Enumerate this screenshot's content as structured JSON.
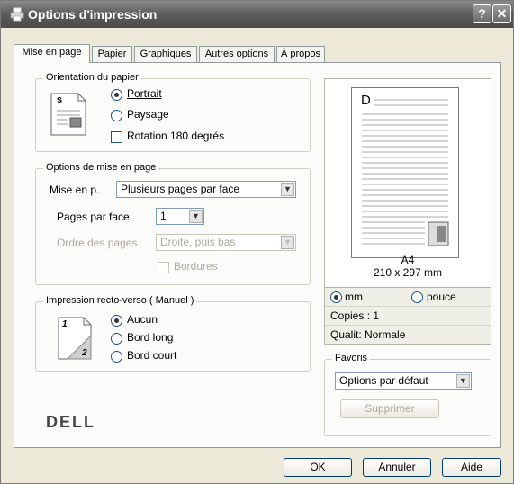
{
  "window": {
    "title": "Options d'impression",
    "help_label": "?",
    "close_label": "✕"
  },
  "tabs": [
    {
      "label": "Mise en page",
      "active": true
    },
    {
      "label": "Papier",
      "active": false
    },
    {
      "label": "Graphiques",
      "active": false
    },
    {
      "label": "Autres options",
      "active": false
    },
    {
      "label": "À propos",
      "active": false
    }
  ],
  "orientation": {
    "title": "Orientation du papier",
    "portrait": "Portrait",
    "landscape": "Paysage",
    "rotate": "Rotation 180 degrés",
    "selected": "portrait",
    "icon_letter": "s"
  },
  "layout": {
    "title": "Options de mise en page",
    "type_label": "Mise en p.",
    "type_value": "Plusieurs pages par face",
    "pages_label": "Pages par face",
    "pages_value": "1",
    "order_label": "Ordre des pages",
    "order_value": "Droite, puis bas",
    "borders_label": "Bordures"
  },
  "duplex": {
    "title": "Impression recto-verso ( Manuel )",
    "none": "Aucun",
    "long_edge": "Bord long",
    "short_edge": "Bord court",
    "selected": "none",
    "icon_top": "1",
    "icon_bottom": "2"
  },
  "preview": {
    "page_letter": "D",
    "paper_name": "A4",
    "paper_size": "210 x 297 mm",
    "unit_mm": "mm",
    "unit_inch": "pouce",
    "unit_selected": "mm",
    "copies": "Copies : 1",
    "quality": "Qualit: Normale"
  },
  "favorites": {
    "title": "Favoris",
    "value": "Options par défaut",
    "delete_label": "Supprimer"
  },
  "brand": "DELL",
  "footer": {
    "ok": "OK",
    "cancel": "Annuler",
    "help": "Aide"
  }
}
